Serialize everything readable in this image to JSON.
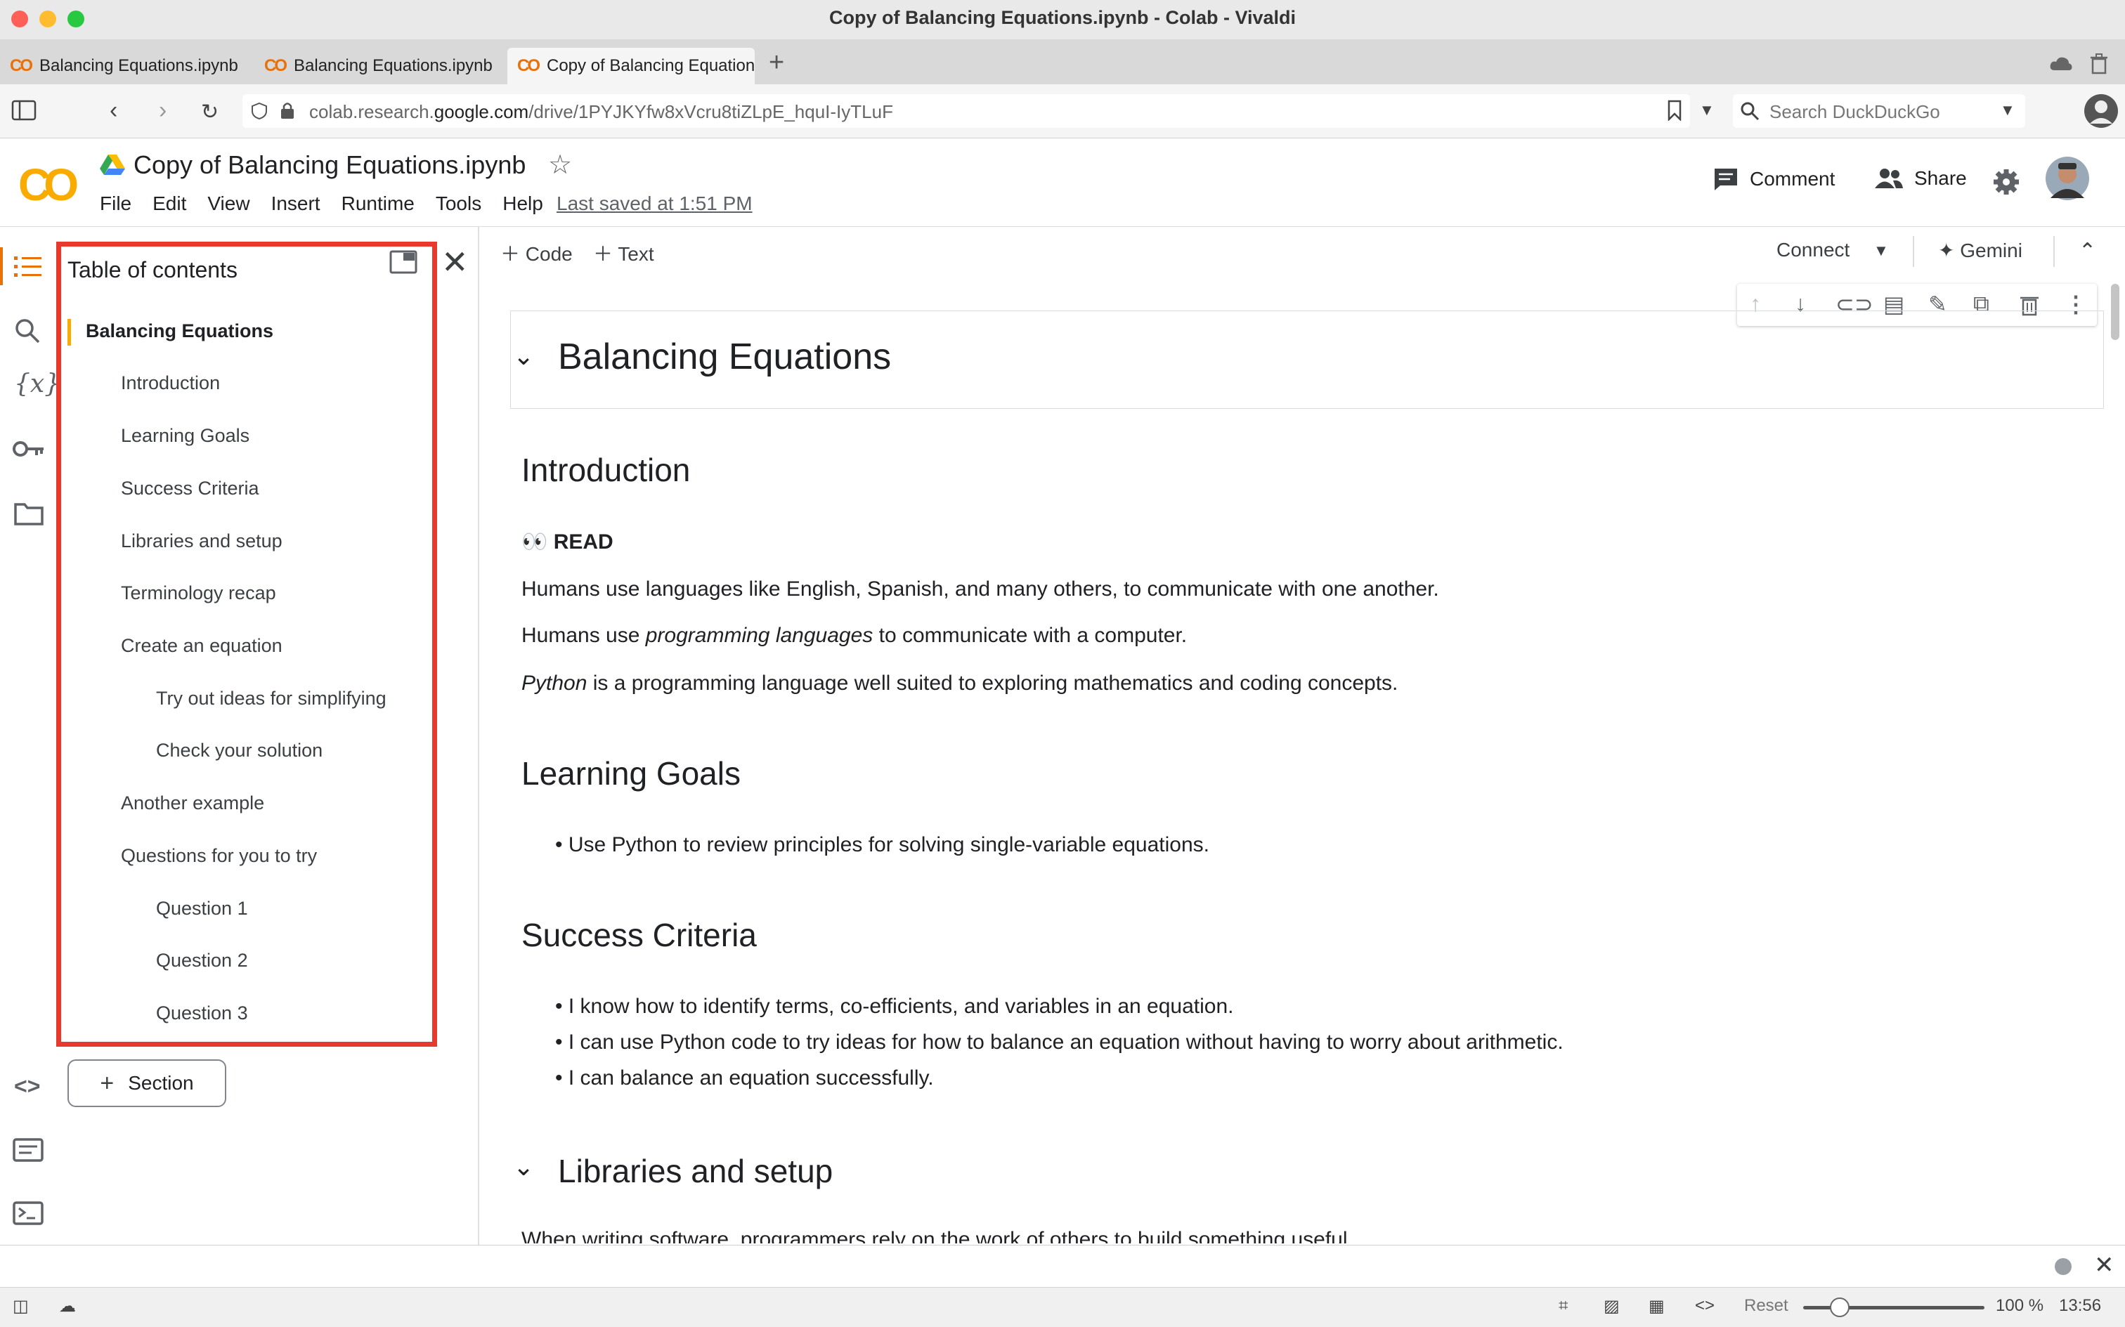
{
  "window": {
    "title": "Copy of Balancing Equations.ipynb - Colab - Vivaldi"
  },
  "tabs": [
    {
      "label": "Balancing Equations.ipynb"
    },
    {
      "label": "Balancing Equations.ipynb"
    },
    {
      "label": "Copy of Balancing Equation"
    }
  ],
  "address": {
    "url_prefix": "colab.research.",
    "url_domain": "google.com",
    "url_path": "/drive/1PYJKYfw8xVcru8tiZLpE_hquI-IyTLuF",
    "search_placeholder": "Search DuckDuckGo"
  },
  "colab": {
    "logo": "CO",
    "title": "Copy of Balancing Equations.ipynb",
    "menu": [
      "File",
      "Edit",
      "View",
      "Insert",
      "Runtime",
      "Tools",
      "Help"
    ],
    "last_saved": "Last saved at 1:51 PM",
    "comment_label": "Comment",
    "share_label": "Share"
  },
  "toc": {
    "title": "Table of contents",
    "items": [
      {
        "label": "Balancing Equations",
        "level": 1
      },
      {
        "label": "Introduction",
        "level": 2
      },
      {
        "label": "Learning Goals",
        "level": 2
      },
      {
        "label": "Success Criteria",
        "level": 2
      },
      {
        "label": "Libraries and setup",
        "level": 2
      },
      {
        "label": "Terminology recap",
        "level": 2
      },
      {
        "label": "Create an equation",
        "level": 2
      },
      {
        "label": "Try out ideas for simplifying",
        "level": 3
      },
      {
        "label": "Check your solution",
        "level": 3
      },
      {
        "label": "Another example",
        "level": 2
      },
      {
        "label": "Questions for you to try",
        "level": 2
      },
      {
        "label": "Question 1",
        "level": 3
      },
      {
        "label": "Question 2",
        "level": 3
      },
      {
        "label": "Question 3",
        "level": 3
      }
    ],
    "section_button": "Section"
  },
  "toolbar": {
    "code": "Code",
    "text": "Text",
    "connect": "Connect",
    "gemini": "Gemini"
  },
  "notebook": {
    "h1": "Balancing Equations",
    "intro_heading": "Introduction",
    "read_label": "READ",
    "intro_p1": "Humans use languages like English, Spanish, and many others, to communicate with one another.",
    "intro_p2_a": "Humans use ",
    "intro_p2_em": "programming languages",
    "intro_p2_b": " to communicate with a computer.",
    "intro_p3_em": "Python",
    "intro_p3_b": " is a programming language well suited to exploring mathematics and coding concepts.",
    "goals_heading": "Learning Goals",
    "goals": [
      "Use Python to review principles for solving single-variable equations."
    ],
    "criteria_heading": "Success Criteria",
    "criteria": [
      "I know how to identify terms, co-efficients, and variables in an equation.",
      "I can use Python code to try ideas for how to balance an equation without having to worry about arithmetic.",
      "I can balance an equation successfully."
    ],
    "libs_heading": "Libraries and setup",
    "libs_p": "When writing software, programmers rely on the work of others to build something useful."
  },
  "statusbar": {
    "reset": "Reset",
    "zoom": "100 %",
    "time": "13:56",
    "zoom_level": 0.2
  }
}
